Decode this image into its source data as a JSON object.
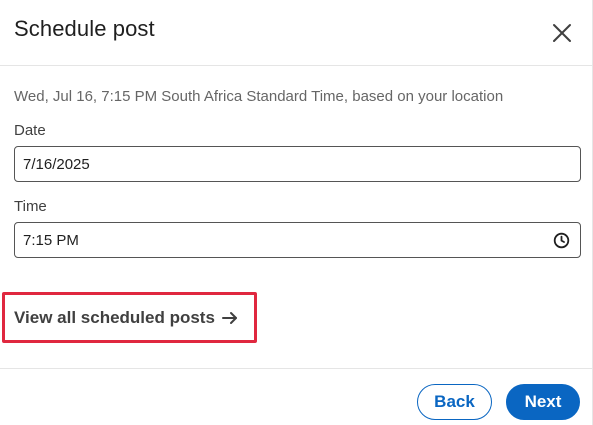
{
  "dialog": {
    "title": "Schedule post",
    "close_icon": "close-icon"
  },
  "schedule": {
    "summary": "Wed, Jul 16, 7:15 PM South Africa Standard Time, based on your location",
    "date_label": "Date",
    "date_value": "7/16/2025",
    "time_label": "Time",
    "time_value": "7:15 PM",
    "time_icon": "clock-icon"
  },
  "links": {
    "view_all_label": "View all scheduled posts",
    "arrow_icon": "arrow-right-icon"
  },
  "footer": {
    "back_label": "Back",
    "next_label": "Next"
  },
  "colors": {
    "primary": "#0a66c2",
    "highlight_border": "#e0283f",
    "text_primary": "#1f1f1f",
    "text_secondary": "#666666"
  }
}
